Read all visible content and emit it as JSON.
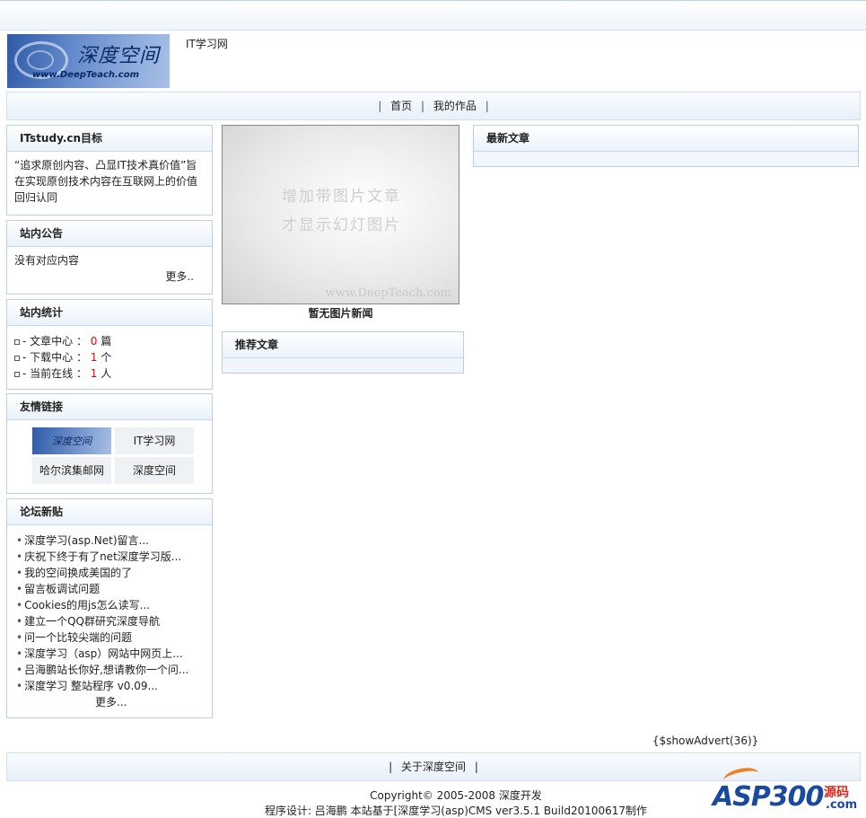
{
  "header": {
    "logo_text": "深度空间",
    "logo_url_text": "www.DeepTeach.com",
    "site_name": "IT学习网"
  },
  "nav": {
    "items": [
      "首页",
      "我的作品"
    ]
  },
  "goal_box": {
    "title": "ITstudy.cn目标",
    "text": "“追求原创内容、凸显IT技术真价值”旨在实现原创技术内容在互联网上的价值回归认同"
  },
  "notice_box": {
    "title": "站内公告",
    "text": "没有对应内容",
    "more": "更多.."
  },
  "stats_box": {
    "title": "站内统计",
    "rows": [
      {
        "label": "- 文章中心 ：",
        "value": "0",
        "unit": "篇"
      },
      {
        "label": "- 下载中心 ：",
        "value": "1",
        "unit": "个"
      },
      {
        "label": "- 当前在线 ：",
        "value": "1",
        "unit": "人"
      }
    ]
  },
  "links_box": {
    "title": "友情链接",
    "logo_text": "深度空间",
    "items": [
      "IT学习网",
      "哈尔滨集邮网",
      "深度空间"
    ]
  },
  "forum_box": {
    "title": "论坛新贴",
    "items": [
      "深度学习(asp.Net)留言...",
      "庆祝下终于有了net深度学习版...",
      "我的空间换成美国的了",
      "留言板调试问题",
      "Cookies的用js怎么读写...",
      "建立一个QQ群研究深度导航",
      "问一个比较尖端的问题",
      "深度学习（asp）网站中网页上...",
      "吕海鹏站长你好,想请教你一个问...",
      "深度学习  整站程序  v0.09..."
    ],
    "more": "更多..."
  },
  "slide": {
    "line1": "增加带图片文章",
    "line2": "才显示幻灯图片",
    "watermark": "www.DeepTeach.com",
    "caption": "暂无图片新闻"
  },
  "recommend_box": {
    "title": "推荐文章"
  },
  "latest_box": {
    "title": "最新文章"
  },
  "advert": "{$showAdvert(36)}",
  "footer": {
    "link": "关于深度空间",
    "copyright": "Copyright© 2005-2008 深度开发",
    "credit": "程序设计: 吕海鹏  本站基于[深度学习(asp)CMS ver3.5.1 Build20100617制作"
  },
  "watermark_logo": {
    "main": "ASP300",
    "cn": "源码",
    "dom": ".com"
  }
}
